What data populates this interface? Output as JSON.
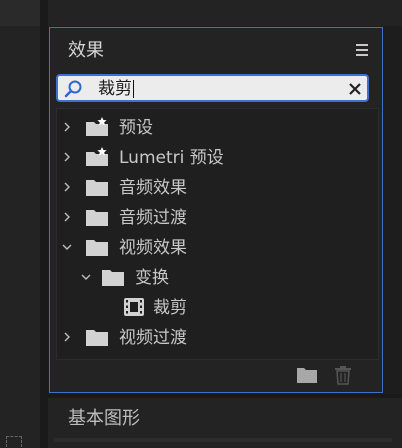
{
  "effects_panel": {
    "title": "效果",
    "search": {
      "value": "裁剪"
    },
    "tree": [
      {
        "label": "预设",
        "type": "preset-folder",
        "expanded": false
      },
      {
        "label": "Lumetri 预设",
        "type": "preset-folder",
        "expanded": false
      },
      {
        "label": "音频效果",
        "type": "folder",
        "expanded": false
      },
      {
        "label": "音频过渡",
        "type": "folder",
        "expanded": false
      },
      {
        "label": "视频效果",
        "type": "folder",
        "expanded": true
      },
      {
        "label": "变换",
        "type": "folder",
        "expanded": true
      },
      {
        "label": "裁剪",
        "type": "effect"
      },
      {
        "label": "视频过渡",
        "type": "folder",
        "expanded": false
      }
    ]
  },
  "lower_panel": {
    "title": "基本图形"
  },
  "colors": {
    "accent": "#3f6fcf",
    "panel_bg": "#232323",
    "text": "#c8c8c8"
  }
}
